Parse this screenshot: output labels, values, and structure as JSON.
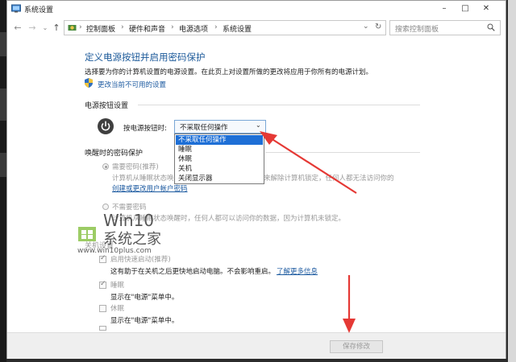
{
  "window": {
    "title": "系统设置",
    "controls": {
      "minimize": "–",
      "maximize": "□",
      "close": "✕"
    }
  },
  "address_bar": {
    "breadcrumbs": [
      "控制面板",
      "硬件和声音",
      "电源选项",
      "系统设置"
    ],
    "separator": "›",
    "search_placeholder": "搜索控制面板"
  },
  "page": {
    "title": "定义电源按钮并启用密码保护",
    "description": "选择要为你的计算机设置的电源设置。在此页上对设置所做的更改将应用于你所有的电源计划。",
    "change_settings_link": "更改当前不可用的设置"
  },
  "power_buttons": {
    "section_title": "电源按钮设置",
    "label": "按电源按钮时:",
    "selected": "不采取任何操作",
    "options": [
      "不采取任何操作",
      "睡眠",
      "休眠",
      "关机",
      "关闭显示器"
    ]
  },
  "wake_password": {
    "section_title": "唤醒时的密码保护",
    "require": {
      "label": "需要密码(推荐)",
      "desc_a": "计算机从睡眠状态唤醒",
      "desc_b": "来解除计算机锁定，任何人都无法访问你的",
      "link": "创建或更改用户帐户密码"
    },
    "no_require": {
      "label": "不需要密码",
      "desc": "计算机从睡眠状态唤醒时，任何人都可以访问你的数据，因为计算机未锁定。"
    }
  },
  "shutdown": {
    "section_title": "关机设置",
    "fast_startup": {
      "label": "启用快速启动(推荐)",
      "desc": "这有助于在关机之后更快地启动电脑。不会影响重启。",
      "link": "了解更多信息",
      "checked": true
    },
    "sleep": {
      "label": "睡眠",
      "desc": "显示在\"电源\"菜单中。",
      "checked": true
    },
    "hibernate": {
      "label": "休眠",
      "desc": "显示在\"电源\"菜单中。",
      "checked": false
    }
  },
  "watermark": {
    "title": "Win10",
    "subtitle": "系统之家",
    "url": "www.win10plus.com"
  },
  "footer": {
    "save_label": "保存修改"
  },
  "colors": {
    "accent": "#1c5a9a",
    "link": "#1c5aa0",
    "selection": "#1e6fd6",
    "annotation": "#e53935"
  }
}
